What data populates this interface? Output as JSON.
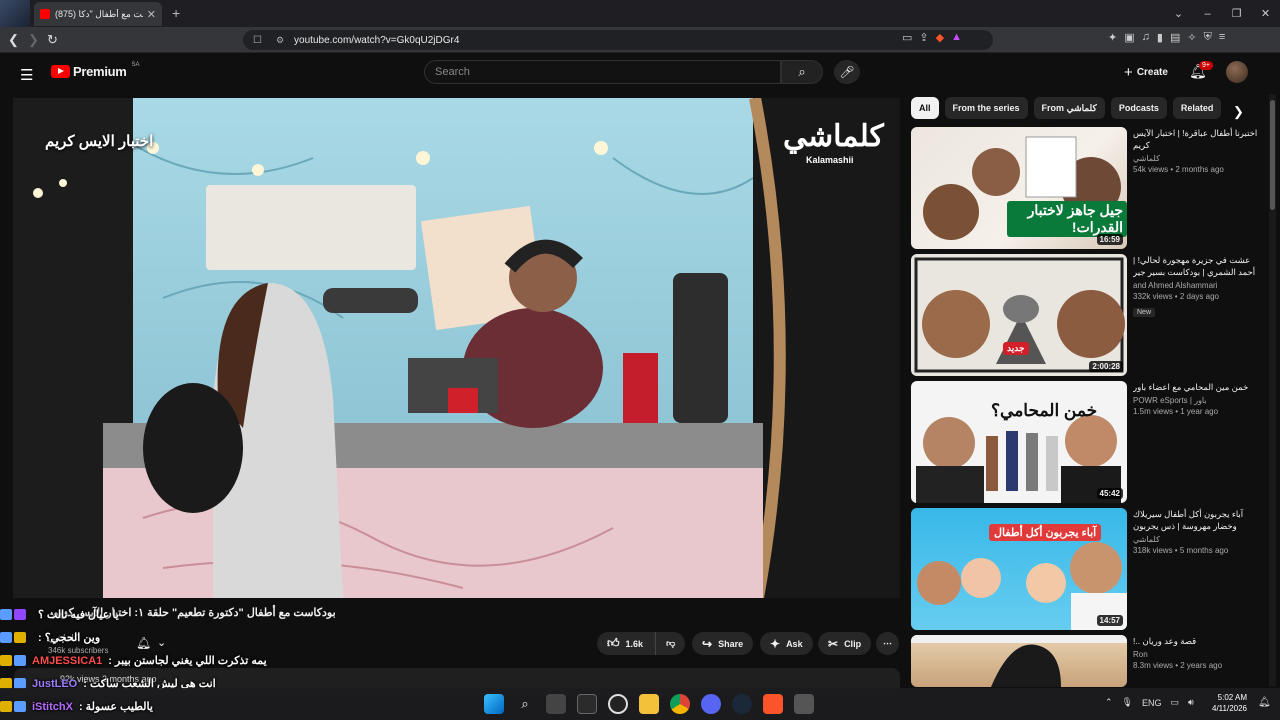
{
  "browser": {
    "tab_title": "(875) بودكاست مع أطفال \"دكا",
    "tab_close": "✕",
    "new_tab": "+",
    "url": "youtube.com/watch?v=Gk0qU2jDGr4",
    "window_controls": [
      "⌄",
      "–",
      "❐",
      "✕"
    ]
  },
  "youtube": {
    "brand": "Premium",
    "region": "SA",
    "search_placeholder": "Search",
    "create_label": "Create",
    "notification_count": "9+"
  },
  "player": {
    "overlay_title": "اختبار الايس كريم",
    "channel_logo": "كلماشي",
    "channel_logo_latin": "Kalamashii"
  },
  "video": {
    "title": "بودكاست مع أطفال \"دكتورة تطعيم\" حلقة ١: اختبار الآيس كريم",
    "channel": "كلماشي",
    "subscribers": "346k subscribers",
    "likes": "1.6k",
    "share": "Share",
    "ask": "Ask",
    "clip": "Clip",
    "description_stats": "92k views  2 months ago"
  },
  "chips": [
    "All",
    "From the series",
    "From كلماشي",
    "Podcasts",
    "Related"
  ],
  "recommendations": [
    {
      "title": "اختبرنا أطفال عباقرة! | اختبار الآيس كريم",
      "channel": "كلماشي",
      "views": "54k views • 2 months ago",
      "duration": "16:59",
      "thumb_text": "جيل جاهز لاختبار القدرات!",
      "badge": ""
    },
    {
      "title": "عشت في جزيرة مهجورة لحالي! | أحمد الشمري | بودكاست بسير جير",
      "channel": "and Ahmed Alshammari",
      "views": "332k views • 2 days ago",
      "duration": "2:00:28",
      "thumb_text": "جديد",
      "badge": "New"
    },
    {
      "title": "خمن مين المحامي مع اعضاء باور",
      "channel": "POWR eSports | باور",
      "views": "1.5m views • 1 year ago",
      "duration": "45:42",
      "thumb_text": "خمن المحامي؟",
      "badge": ""
    },
    {
      "title": "آباء يجربون أكل أطفال سيريلاك وخضار مهروسة | ذس يجربون",
      "channel": "كلماشي",
      "views": "318k views • 5 months ago",
      "duration": "14:57",
      "thumb_text": "آباء يجربون أكل أطفال",
      "badge": ""
    },
    {
      "title": "قصة وعد وريان ..!",
      "channel": "Ron",
      "views": "8.3m views • 2 years ago",
      "duration": "",
      "thumb_text": "",
      "badge": ""
    }
  ],
  "chat": [
    {
      "name": "",
      "text": "يا عيال فيه ثالث ؟",
      "color": "#9146ff"
    },
    {
      "name": "",
      "text": "وين الحجي؟ :",
      "color": "#9146ff"
    },
    {
      "name": "AMJESSICA1",
      "text": "يمه تذكرت اللي يغني لجاستن بيبر :",
      "color": "#ff4d4d"
    },
    {
      "name": "JustLEO",
      "text": "انت هي ليش الشعب ساكت :",
      "color": "#9d7cff"
    },
    {
      "name": "iStitchX",
      "text": "يالطيب عسولة :",
      "color": "#b46cff"
    }
  ],
  "system": {
    "lang": "ENG",
    "time": "5:02 AM",
    "date": "4/11/2026"
  }
}
